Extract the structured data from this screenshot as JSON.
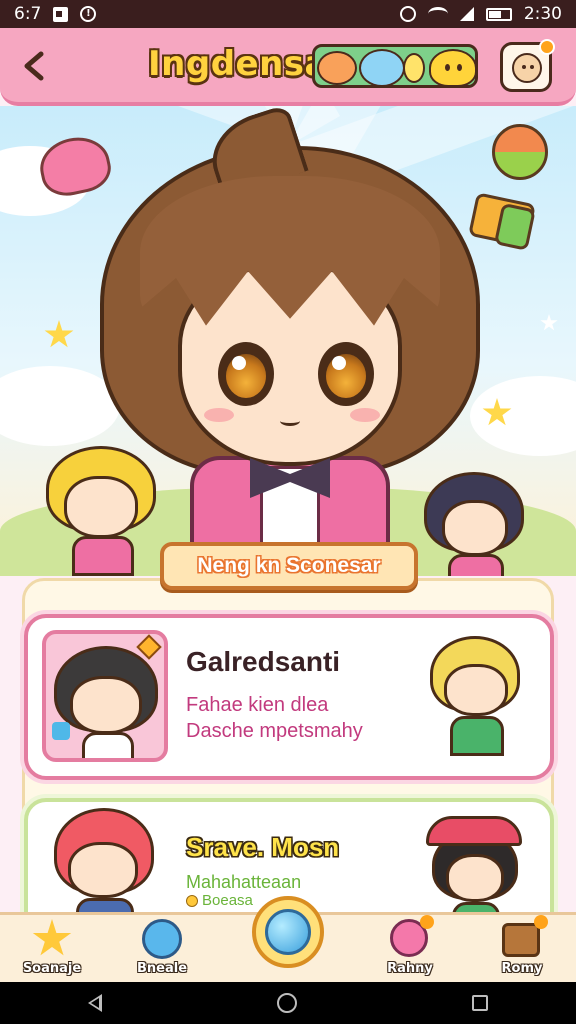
{
  "status_bar": {
    "time": "6:7",
    "clock": "2:30",
    "icons": [
      "notification-icon",
      "info-icon",
      "alarm-icon",
      "wifi-icon",
      "signal-icon",
      "battery-icon"
    ]
  },
  "header": {
    "title": "Ingdensa",
    "back_icon": "chevron-left-icon",
    "avatar_icon": "profile-avatar-icon"
  },
  "section_banner": {
    "label": "Neng kn Sconesar"
  },
  "cards": [
    {
      "title": "Galredsanti",
      "line_1": "Fahae kien dlea",
      "line_2": "Dasche mpetsmahy"
    },
    {
      "title": "Srave. Mosn",
      "line_1": "Mahahatteaan",
      "line_2": "Boeasa"
    }
  ],
  "bottom_nav": {
    "items": [
      {
        "label": "Soanaje",
        "icon": "star-icon"
      },
      {
        "label": "Bneale",
        "icon": "globe-icon"
      },
      {
        "label": "Rahny",
        "icon": "pink-character-icon"
      },
      {
        "label": "Romy",
        "icon": "brown-character-icon"
      }
    ],
    "center_icon": "orb-icon"
  },
  "colors": {
    "header_bg": "#f6a7c1",
    "title_yellow": "#ffd23f",
    "card_border_pink": "#e47ca0",
    "card_border_green": "#c9e39a",
    "nav_bg": "#fcefd9"
  }
}
